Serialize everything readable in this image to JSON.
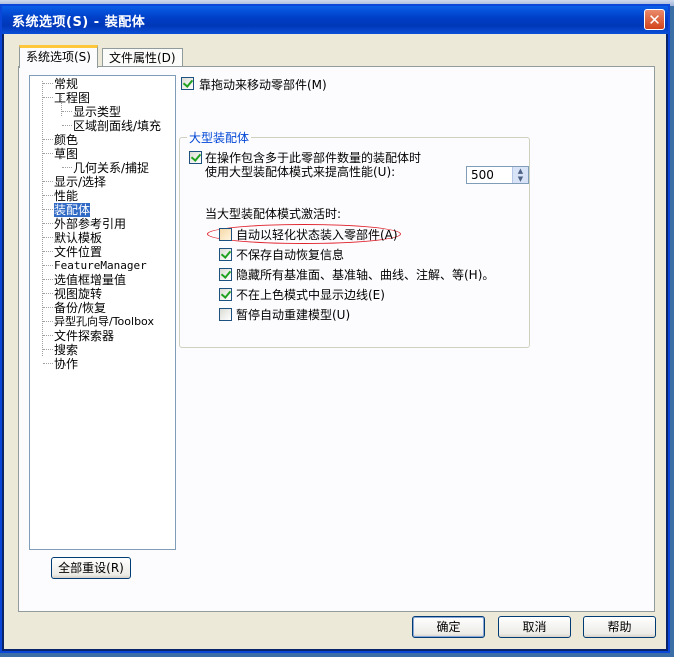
{
  "window": {
    "title": "系统选项(S) - 装配体",
    "close_symbol": "✕"
  },
  "tabs": [
    {
      "label": "系统选项(S)"
    },
    {
      "label": "文件属性(D)"
    }
  ],
  "tree": {
    "items": [
      "常规",
      "工程图",
      "显示类型",
      "区域剖面线/填充",
      "颜色",
      "草图",
      "几何关系/捕捉",
      "显示/选择",
      "性能",
      "装配体",
      "外部参考引用",
      "默认模板",
      "文件位置",
      "FeatureManager",
      "选值框增量值",
      "视图旋转",
      "备份/恢复",
      "异型孔向导/Toolbox",
      "文件探索器",
      "搜索",
      "协作"
    ],
    "selected": "装配体"
  },
  "reset_button": "全部重设(R)",
  "options": {
    "move_by_drag": {
      "label": "靠拖动来移动零部件(M)",
      "checked": true
    },
    "large_assembly": {
      "legend": "大型装配体",
      "threshold_label_1": "在操作包含多于此零部件数量的装配体时",
      "threshold_label_2": "使用大型装配体模式来提高性能(U):",
      "threshold_checked": true,
      "threshold_value": "500",
      "when_active": "当大型装配体模式激活时:",
      "sub": [
        {
          "label": "自动以轻化状态装入零部件(A)",
          "checked": false
        },
        {
          "label": "不保存自动恢复信息",
          "checked": true
        },
        {
          "label": "隐藏所有基准面、基准轴、曲线、注解、等(H)。",
          "checked": true
        },
        {
          "label": "不在上色模式中显示边线(E)",
          "checked": true
        },
        {
          "label": "暂停自动重建模型(U)",
          "checked": false
        }
      ]
    }
  },
  "buttons": {
    "ok": "确定",
    "cancel": "取消",
    "help": "帮助"
  }
}
